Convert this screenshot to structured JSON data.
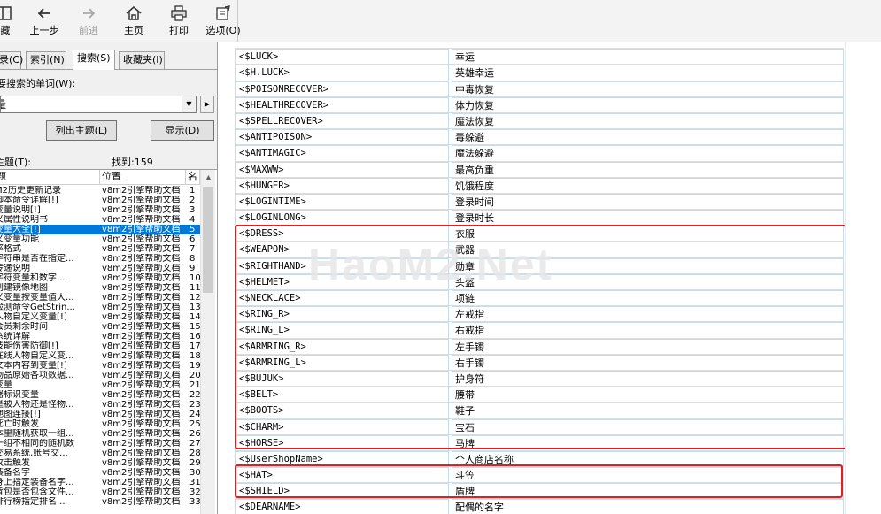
{
  "toolbar": {
    "items": [
      {
        "label": "藏",
        "icon": "hide-icon"
      },
      {
        "label": "上一步",
        "icon": "back-icon"
      },
      {
        "label": "前进",
        "icon": "forward-icon",
        "disabled": true
      },
      {
        "label": "主页",
        "icon": "home-icon"
      },
      {
        "label": "打印",
        "icon": "print-icon"
      },
      {
        "label": "选项(O)",
        "icon": "options-icon"
      }
    ]
  },
  "sidebar": {
    "tabs": [
      {
        "label": "录(C)"
      },
      {
        "label": "索引(N)"
      },
      {
        "label": "搜索(S)",
        "active": true
      },
      {
        "label": "收藏夹(I)"
      }
    ],
    "prompt": "要搜索的单词(W):",
    "search_value": "量",
    "list_topics_button": "列出主题(L)",
    "display_button": "显示(D)",
    "select_topic_label": "主题(T):",
    "found_label": "找到:159",
    "columns": [
      "题",
      "位置",
      "名"
    ],
    "rows": [
      {
        "title": "M2历史更新记录",
        "location": "v8m2引擎帮助文档",
        "rank": "1"
      },
      {
        "title": "脚本命令详解[!]",
        "location": "v8m2引擎帮助文档",
        "rank": "2"
      },
      {
        "title": "变量说明[!]",
        "location": "v8m2引擎帮助文档",
        "rank": "3"
      },
      {
        "title": "义属性说明书",
        "location": "v8m2引擎帮助文档",
        "rank": "4"
      },
      {
        "title": "变量大全[!]",
        "location": "v8m2引擎帮助文档",
        "rank": "5",
        "selected": true
      },
      {
        "title": "义变量功能",
        "location": "v8m2引擎帮助文档",
        "rank": "6"
      },
      {
        "title": "率格式",
        "location": "v8m2引擎帮助文档",
        "rank": "7"
      },
      {
        "title": "字符串是否在指定...",
        "location": "v8m2引擎帮助文档",
        "rank": "8"
      },
      {
        "title": "传递说明",
        "location": "v8m2引擎帮助文档",
        "rank": "9"
      },
      {
        "title": "字符变量和数字...",
        "location": "v8m2引擎帮助文档",
        "rank": "10"
      },
      {
        "title": "创建镜像地图",
        "location": "v8m2引擎帮助文档",
        "rank": "11"
      },
      {
        "title": "义变量按变量值大...",
        "location": "v8m2引擎帮助文档",
        "rank": "12"
      },
      {
        "title": "检测命令GetStrin...",
        "location": "v8m2引擎帮助文档",
        "rank": "13"
      },
      {
        "title": "人物自定义变量[!]",
        "location": "v8m2引擎帮助文档",
        "rank": "14"
      },
      {
        "title": "会员剩余时间",
        "location": "v8m2引擎帮助文档",
        "rank": "15"
      },
      {
        "title": "系统详解",
        "location": "v8m2引擎帮助文档",
        "rank": "16"
      },
      {
        "title": "技能伤害防御[!]",
        "location": "v8m2引擎帮助文档",
        "rank": "17"
      },
      {
        "title": "在线人物自定义变...",
        "location": "v8m2引擎帮助文档",
        "rank": "18"
      },
      {
        "title": "文本内容到变量[!]",
        "location": "v8m2引擎帮助文档",
        "rank": "19"
      },
      {
        "title": "物品原始各项数据...",
        "location": "v8m2引擎帮助文档",
        "rank": "20"
      },
      {
        "title": "变量",
        "location": "v8m2引擎帮助文档",
        "rank": "21"
      },
      {
        "title": "器标识变量",
        "location": "v8m2引擎帮助文档",
        "rank": "22"
      },
      {
        "title": "是被人物还是怪物...",
        "location": "v8m2引擎帮助文档",
        "rank": "23"
      },
      {
        "title": "地图连接[!]",
        "location": "v8m2引擎帮助文档",
        "rank": "24"
      },
      {
        "title": "死亡时触发",
        "location": "v8m2引擎帮助文档",
        "rank": "25"
      },
      {
        "title": "本里随机获取一组...",
        "location": "v8m2引擎帮助文档",
        "rank": "26"
      },
      {
        "title": "一组不相同的随机数",
        "location": "v8m2引擎帮助文档",
        "rank": "27"
      },
      {
        "title": "交易系统,账号交...",
        "location": "v8m2引擎帮助文档",
        "rank": "28"
      },
      {
        "title": "攻击触发",
        "location": "v8m2引擎帮助文档",
        "rank": "29"
      },
      {
        "title": "装备名字",
        "location": "v8m2引擎帮助文档",
        "rank": "30"
      },
      {
        "title": "身上指定装备名字...",
        "location": "v8m2引擎帮助文档",
        "rank": "31"
      },
      {
        "title": "背包是否包含文件...",
        "location": "v8m2引擎帮助文档",
        "rank": "32"
      },
      {
        "title": "排行榜指定排名...",
        "location": "v8m2引擎帮助文档",
        "rank": "33"
      }
    ]
  },
  "content": {
    "rows": [
      {
        "key": "<$LUCK>",
        "value": "幸运"
      },
      {
        "key": "<$H.LUCK>",
        "value": "英雄幸运"
      },
      {
        "key": "<$POISONRECOVER>",
        "value": "中毒恢复"
      },
      {
        "key": "<$HEALTHRECOVER>",
        "value": "体力恢复"
      },
      {
        "key": "<$SPELLRECOVER>",
        "value": "魔法恢复"
      },
      {
        "key": "<$ANTIPOISON>",
        "value": "毒躲避"
      },
      {
        "key": "<$ANTIMAGIC>",
        "value": "魔法躲避"
      },
      {
        "key": "<$MAXWW>",
        "value": "最高负重"
      },
      {
        "key": "<$HUNGER>",
        "value": "饥饿程度"
      },
      {
        "key": "<$LOGINTIME>",
        "value": "登录时间"
      },
      {
        "key": "<$LOGINLONG>",
        "value": "登录时长"
      },
      {
        "key": "<$DRESS>",
        "value": "衣服"
      },
      {
        "key": "<$WEAPON>",
        "value": "武器"
      },
      {
        "key": "<$RIGHTHAND>",
        "value": "勋章"
      },
      {
        "key": "<$HELMET>",
        "value": "头盔"
      },
      {
        "key": "<$NECKLACE>",
        "value": "项链"
      },
      {
        "key": "<$RING_R>",
        "value": "左戒指"
      },
      {
        "key": "<$RING_L>",
        "value": "右戒指"
      },
      {
        "key": "<$ARMRING_R>",
        "value": "左手镯"
      },
      {
        "key": "<$ARMRING_L>",
        "value": "右手镯"
      },
      {
        "key": "<$BUJUK>",
        "value": "护身符"
      },
      {
        "key": "<$BELT>",
        "value": "腰带"
      },
      {
        "key": "<$BOOTS>",
        "value": "鞋子"
      },
      {
        "key": "<$CHARM>",
        "value": "宝石"
      },
      {
        "key": "<$HORSE>",
        "value": "马牌"
      },
      {
        "key": "<$UserShopName>",
        "value": "个人商店名称"
      },
      {
        "key": "<$HAT>",
        "value": "斗笠"
      },
      {
        "key": "<$SHIELD>",
        "value": "盾牌"
      },
      {
        "key": "<$DEARNAME>",
        "value": "配偶的名字"
      }
    ],
    "watermark": "HaoM2.Net",
    "highlight_color": "#e02020"
  }
}
